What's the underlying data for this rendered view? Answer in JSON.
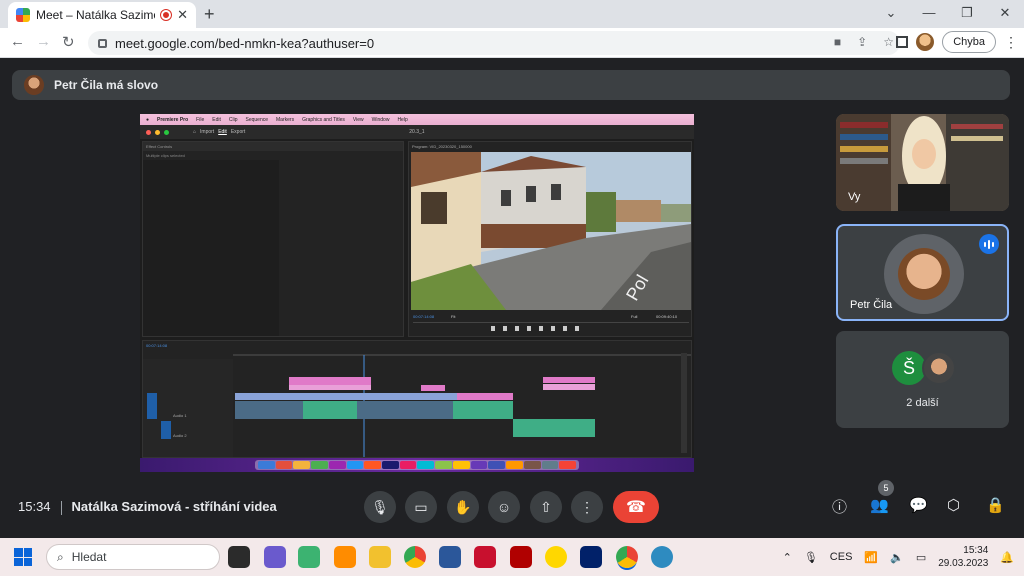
{
  "browser": {
    "tab_title": "Meet – Natálka Sazimová - s",
    "url": "meet.google.com/bed-nmkn-kea?authuser=0",
    "profile_button": "Chyba"
  },
  "meet": {
    "speaker_banner": "Petr Čila má slovo",
    "meeting_time": "15:34",
    "meeting_title": "Natálka Sazimová - stříhání videa",
    "participants_badge": "5",
    "tiles": {
      "self_name": "Vy",
      "active_name": "Petr Čila",
      "more_label": "2 další",
      "more_initial": "Š"
    }
  },
  "shared_screen": {
    "menubar_items": [
      "Premiere Pro",
      "File",
      "Edit",
      "Clip",
      "Sequence",
      "Markers",
      "Graphics and Titles",
      "View",
      "Window",
      "Help"
    ],
    "header_tabs": [
      "Import",
      "Edit",
      "Export"
    ],
    "project_name": "20.3_1",
    "panel_left_header": "Effect Controls",
    "panel_left_text": "Multiple clips selected",
    "program_header": "Program: VID_20230320_150000",
    "timecode_left": "00:07:14:08",
    "timecode_right": "00:09:40:10",
    "fit_label": "Fit",
    "full_label": "Full",
    "timeline_timecode": "00:07:14:08",
    "audio_labels": [
      "Audio 1",
      "Audio 2"
    ]
  },
  "taskbar": {
    "search_placeholder": "Hledat",
    "language": "CES",
    "time": "15:34",
    "date": "29.03.2023"
  },
  "colors": {
    "meet_bg": "#202124",
    "end_call": "#ea4335",
    "active_border": "#8ab4f8",
    "speaking_badge": "#1a73e8",
    "premiere_menubar": "#f4c1dd"
  }
}
